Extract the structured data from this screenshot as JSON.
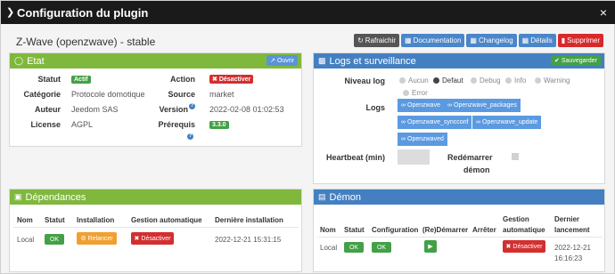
{
  "window": {
    "title": "Configuration du plugin",
    "close": "×"
  },
  "plugin": {
    "name": "Z-Wave (openzwave) - stable"
  },
  "toolbar": {
    "refresh": "Rafraichir",
    "documentation": "Documentation",
    "changelog": "Changelog",
    "details": "Détails",
    "delete": "Supprimer"
  },
  "etat": {
    "title": "Etat",
    "open_button": "Ouvrir",
    "statut_label": "Statut",
    "statut_value": "Actif",
    "categorie_label": "Catégorie",
    "categorie_value": "Protocole domotique",
    "auteur_label": "Auteur",
    "auteur_value": "Jeedom SAS",
    "license_label": "License",
    "license_value": "AGPL",
    "action_label": "Action",
    "action_button": "Désactiver",
    "source_label": "Source",
    "source_value": "market",
    "version_label": "Version",
    "version_value": "2022-02-08 01:02:53",
    "prerequis_label": "Prérequis",
    "prerequis_value": "3.3.0"
  },
  "logs": {
    "title": "Logs et surveillance",
    "save_button": "Sauvegarder",
    "niveau_label": "Niveau log",
    "levels": [
      "Aucun",
      "Defaut",
      "Debug",
      "Info",
      "Warning",
      "Error"
    ],
    "selected_level": "Defaut",
    "logs_label": "Logs",
    "log_files": [
      "Openzwave",
      "Openzwave_packages",
      "Openzwave_syncconf",
      "Openzwave_update",
      "Openzwaved"
    ],
    "heartbeat_label": "Heartbeat (min)",
    "heartbeat_value": "",
    "restart_label_1": "Redémarrer",
    "restart_label_2": "démon"
  },
  "dependances": {
    "title": "Dépendances",
    "headers": [
      "Nom",
      "Statut",
      "Installation",
      "Gestion automatique",
      "Dernière installation"
    ],
    "row": {
      "nom": "Local",
      "statut": "OK",
      "installation": "Relancer",
      "gestion": "Désactiver",
      "derniere": "2022-12-21 15:31:15"
    }
  },
  "demon": {
    "title": "Démon",
    "headers": [
      "Nom",
      "Statut",
      "Configuration",
      "(Re)Démarrer",
      "Arrêter",
      "Gestion automatique",
      "Dernier lancement"
    ],
    "header_gestion_1": "Gestion",
    "header_gestion_2": "automatique",
    "header_dernier_1": "Dernier",
    "header_dernier_2": "lancement",
    "row": {
      "nom": "Local",
      "statut": "OK",
      "configuration": "OK",
      "gestion": "Désactiver",
      "dernier_1": "2022-12-21",
      "dernier_2": "16:16:23"
    }
  },
  "colors": {
    "green": "#7fb83d",
    "blue": "#4480c1",
    "red": "#d32f2f",
    "titlebar": "#1a1a1a"
  }
}
